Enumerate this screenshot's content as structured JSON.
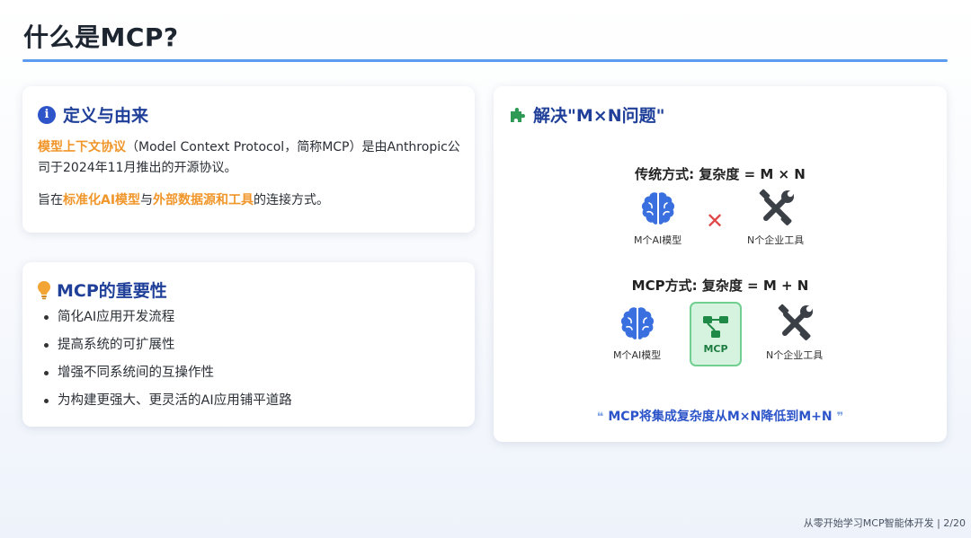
{
  "page": {
    "title": "什么是MCP?",
    "footer": "从零开始学习MCP智能体开发 | 2/20"
  },
  "definition": {
    "heading": "定义与由来",
    "icon": "info-icon",
    "para1_highlight": "模型上下文协议",
    "para1_rest": "（Model Context Protocol，简称MCP）是由Anthropic公司于2024年11月推出的开源协议。",
    "para2_prefix": "旨在",
    "para2_hl1": "标准化AI模型",
    "para2_mid": "与",
    "para2_hl2": "外部数据源和工具",
    "para2_suffix": "的连接方式。",
    "highlight_color": "#f0962a"
  },
  "importance": {
    "heading": "MCP的重要性",
    "icon": "lightbulb-icon",
    "items": [
      "简化AI应用开发流程",
      "提高系统的可扩展性",
      "增强不同系统间的互操作性",
      "为构建更强大、更灵活的AI应用铺平道路"
    ]
  },
  "solution": {
    "heading": "解决\"M×N问题\"",
    "icon": "puzzle-icon",
    "traditional": {
      "title": "传统方式: 复杂度 = M × N",
      "models_label": "M个AI模型",
      "operator": "✕",
      "tools_label": "N个企业工具"
    },
    "mcp": {
      "title": "MCP方式: 复杂度 = M + N",
      "models_label": "M个AI模型",
      "hub_label": "MCP",
      "tools_label": "N个企业工具"
    },
    "quote_open": "❝",
    "quote_text": "MCP将集成复杂度从M×N降低到M+N",
    "quote_close": "❞",
    "colors": {
      "heading": "#1f3f99",
      "brain": "#3a6fe0",
      "tools": "#3b3f46",
      "cross": "#e04848",
      "mcp_fill": "#d5f3df",
      "mcp_border": "#71cf90",
      "mcp_icon": "#1f8a47"
    }
  }
}
